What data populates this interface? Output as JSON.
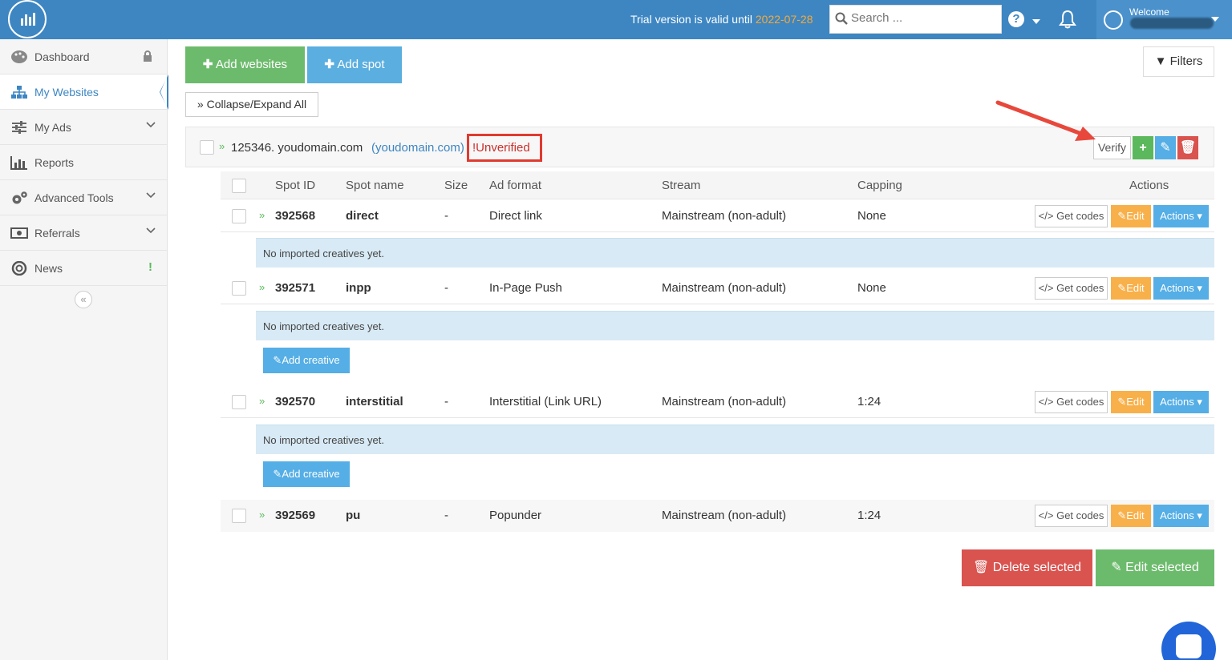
{
  "topbar": {
    "trial_prefix": "Trial version is valid until ",
    "trial_date": "2022-07-28",
    "search_placeholder": "Search ...",
    "welcome": "Welcome"
  },
  "sidebar": {
    "items": [
      {
        "label": "Dashboard",
        "icon": "palette-icon"
      },
      {
        "label": "My Websites",
        "icon": "sitemap-icon"
      },
      {
        "label": "My Ads",
        "icon": "sliders-icon"
      },
      {
        "label": "Reports",
        "icon": "bar-chart-icon"
      },
      {
        "label": "Advanced Tools",
        "icon": "gears-icon"
      },
      {
        "label": "Referrals",
        "icon": "money-icon"
      },
      {
        "label": "News",
        "icon": "lifebuoy-icon"
      }
    ],
    "collapse": "«",
    "news_badge": "!"
  },
  "toolbar": {
    "add_websites": "Add websites",
    "add_spot": "Add spot",
    "collapse_expand": "Collapse/Expand All",
    "filters": "Filters"
  },
  "website": {
    "title": "125346. youdomain.com",
    "link": "(youdomain.com)",
    "status": "!Unverified",
    "verify": "Verify"
  },
  "table": {
    "headers": [
      "Spot ID",
      "Spot name",
      "Size",
      "Ad format",
      "Stream",
      "Capping",
      "Actions"
    ],
    "rows": [
      {
        "id": "392568",
        "name": "direct",
        "size": "-",
        "format": "Direct link",
        "stream": "Mainstream (non-adult)",
        "capping": "None"
      },
      {
        "id": "392571",
        "name": "inpp",
        "size": "-",
        "format": "In-Page Push",
        "stream": "Mainstream (non-adult)",
        "capping": "None"
      },
      {
        "id": "392570",
        "name": "interstitial",
        "size": "-",
        "format": "Interstitial (Link URL)",
        "stream": "Mainstream (non-adult)",
        "capping": "1:24"
      },
      {
        "id": "392569",
        "name": "pu",
        "size": "-",
        "format": "Popunder",
        "stream": "Mainstream (non-adult)",
        "capping": "1:24"
      }
    ],
    "get_codes": "Get codes",
    "edit": "Edit",
    "actions": "Actions",
    "no_creatives": "No imported creatives yet.",
    "add_creative": "Add creative"
  },
  "footer": {
    "delete_selected": "Delete selected",
    "edit_selected": "Edit selected"
  }
}
